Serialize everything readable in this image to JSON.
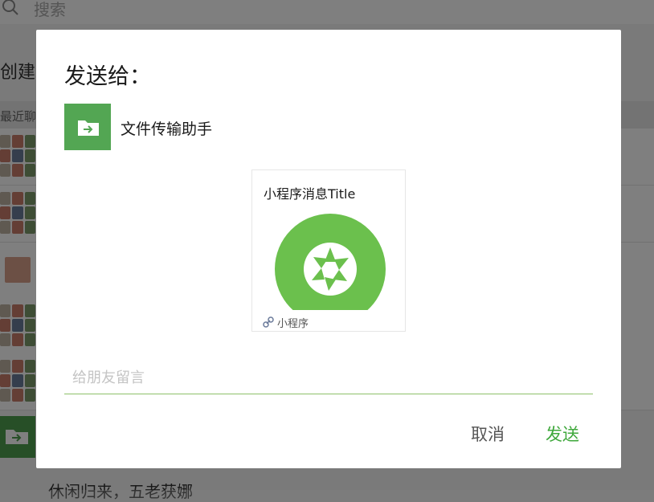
{
  "background": {
    "search_placeholder": "搜索",
    "create_new_partial": "创建新",
    "recent_chats_partial": "最近聊",
    "bottom_text_partial": "休闲归来，五老获娜"
  },
  "dialog": {
    "title": "发送给：",
    "recipient": {
      "name": "文件传输助手",
      "avatar_icon": "folder-arrow-icon"
    },
    "card": {
      "title": "小程序消息Title",
      "image_icon": "camera-shutter-icon",
      "footer_label": "小程序",
      "footer_icon": "link-icon"
    },
    "message_input": {
      "placeholder": "给朋友留言",
      "value": ""
    },
    "buttons": {
      "cancel": "取消",
      "send": "发送"
    }
  },
  "colors": {
    "accent_green": "#3fa83c",
    "avatar_green": "#53a653",
    "card_image_green": "#6bc04d",
    "input_underline": "#8dc06a",
    "overlay": "rgba(0,0,0,0.5)"
  }
}
